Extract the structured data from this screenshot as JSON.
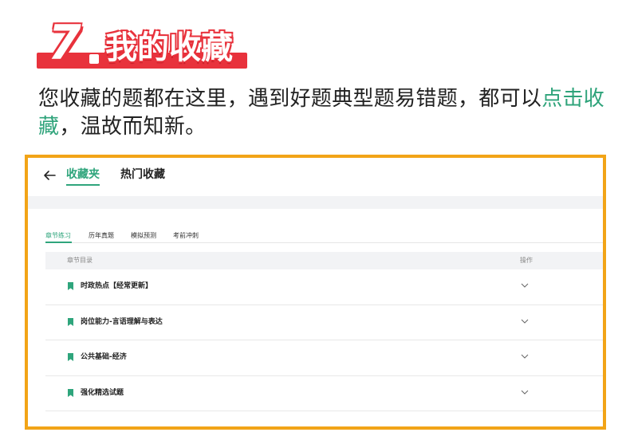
{
  "heading": {
    "number": "7",
    "title": "我的收藏"
  },
  "intro": {
    "text_before": "您收藏的题都在这里，遇到好题典型题易错题，都可以",
    "highlight": "点击收藏",
    "text_after": "，温故而知新。"
  },
  "app": {
    "tabs": [
      {
        "label": "收藏夹",
        "active": true
      },
      {
        "label": "热门收藏",
        "active": false
      }
    ],
    "subtabs": [
      {
        "label": "章节练习",
        "active": true
      },
      {
        "label": "历年真题",
        "active": false
      },
      {
        "label": "模拟预测",
        "active": false
      },
      {
        "label": "考前冲刺",
        "active": false
      }
    ],
    "table": {
      "columns": [
        "章节目录",
        "操作"
      ],
      "rows": [
        {
          "label": "时政热点【经常更新】"
        },
        {
          "label": "岗位能力-言语理解与表达"
        },
        {
          "label": "公共基础-经济"
        },
        {
          "label": "强化精选试题"
        }
      ]
    }
  },
  "colors": {
    "accent": "#2fa57c",
    "heading_red": "#e8323c",
    "frame": "#f2a417"
  }
}
